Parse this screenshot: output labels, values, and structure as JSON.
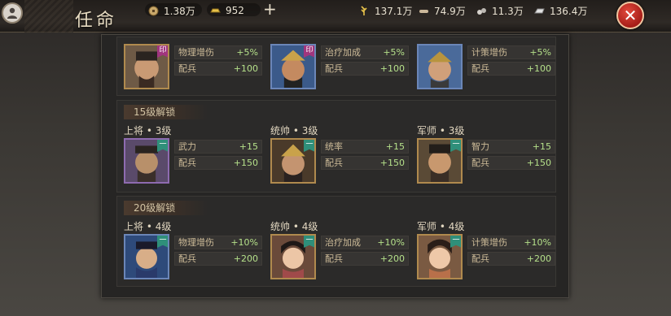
{
  "header": {
    "title": "任命",
    "copper": "1.38万",
    "gold": "952",
    "food": "137.1万",
    "wood": "74.9万",
    "stone": "11.3万",
    "iron": "136.4万",
    "plus": "+",
    "close": "✕"
  },
  "colors": {
    "accent": "#b5e08a",
    "close": "#c0281e",
    "panel": "#262524"
  },
  "sections": [
    {
      "heading": "",
      "slots": [
        {
          "title": "",
          "badge": "",
          "stat1_label": "物理增伤",
          "stat1_value": "+5%",
          "stat2_label": "配兵",
          "stat2_value": "+100"
        },
        {
          "title": "",
          "badge": "",
          "stat1_label": "治疗加成",
          "stat1_value": "+5%",
          "stat2_label": "配兵",
          "stat2_value": "+100"
        },
        {
          "title": "",
          "badge": "",
          "stat1_label": "计策增伤",
          "stat1_value": "+5%",
          "stat2_label": "配兵",
          "stat2_value": "+100"
        }
      ]
    },
    {
      "heading": "15级解锁",
      "slots": [
        {
          "title": "上将 • 3级",
          "badge": "一",
          "stat1_label": "武力",
          "stat1_value": "+15",
          "stat2_label": "配兵",
          "stat2_value": "+150"
        },
        {
          "title": "统帅 • 3级",
          "badge": "一",
          "stat1_label": "统率",
          "stat1_value": "+15",
          "stat2_label": "配兵",
          "stat2_value": "+150"
        },
        {
          "title": "军师 • 3级",
          "badge": "一",
          "stat1_label": "智力",
          "stat1_value": "+15",
          "stat2_label": "配兵",
          "stat2_value": "+150"
        }
      ]
    },
    {
      "heading": "20级解锁",
      "slots": [
        {
          "title": "上将 • 4级",
          "badge": "一",
          "stat1_label": "物理增伤",
          "stat1_value": "+10%",
          "stat2_label": "配兵",
          "stat2_value": "+200"
        },
        {
          "title": "统帅 • 4级",
          "badge": "一",
          "stat1_label": "治疗加成",
          "stat1_value": "+10%",
          "stat2_label": "配兵",
          "stat2_value": "+200"
        },
        {
          "title": "军师 • 4级",
          "badge": "一",
          "stat1_label": "计策增伤",
          "stat1_value": "+10%",
          "stat2_label": "配兵",
          "stat2_value": "+200"
        }
      ]
    }
  ]
}
